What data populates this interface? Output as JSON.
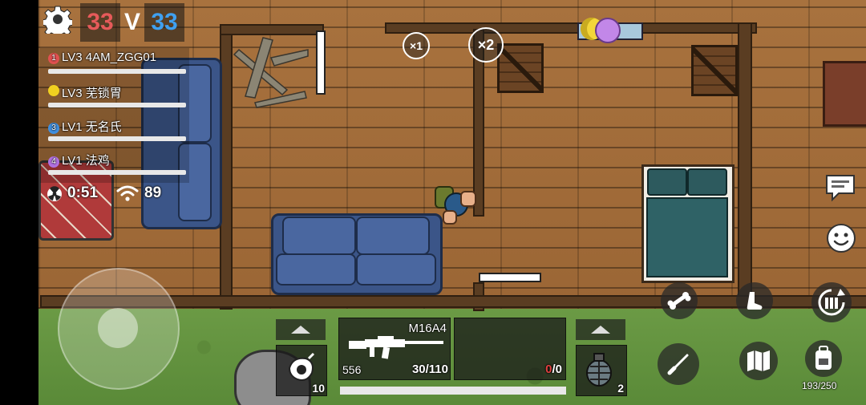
{
  "scoreboard": {
    "left_score": "33",
    "versus": "V",
    "right_score": "33",
    "left_color": "#e65a5a",
    "right_color": "#3fa0f0"
  },
  "players": [
    {
      "badge": "1",
      "badge_color": "#e05050",
      "name": "LV3 4AM_ZGG01"
    },
    {
      "badge": "",
      "badge_color": "#f0d020",
      "name": "LV3 芜锁胃"
    },
    {
      "badge": "3",
      "badge_color": "#3f8fe0",
      "name": "LV1 无名氏"
    },
    {
      "badge": "4",
      "badge_color": "#b070e0",
      "name": "LV1 法鸡"
    }
  ],
  "status": {
    "timer": "0:51",
    "ping": "89",
    "radiation_icon": "radiation-icon",
    "wifi_icon": "wifi-icon"
  },
  "map_markers": {
    "multiplier_1": "×1",
    "multiplier_2": "×2"
  },
  "weapon": {
    "name": "M16A4",
    "total_ammo": "556",
    "magazine": "30/110",
    "secondary_ammo_current": "0",
    "secondary_ammo_total": "/0",
    "secondary_ammo_color": "#e04040"
  },
  "items": {
    "heal_count": "10",
    "grenade_count": "2",
    "backpack_capacity": "193/250"
  },
  "icons": {
    "settings": "gear-icon",
    "chat": "chat-bubble-icon",
    "emote": "smiley-icon",
    "crouch": "bone-icon",
    "prone": "foot-icon",
    "reload": "reload-icon",
    "melee": "knife-icon",
    "map": "map-icon",
    "backpack": "backpack-icon"
  }
}
